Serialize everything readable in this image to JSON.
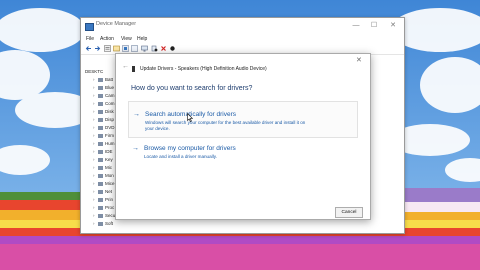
{
  "window": {
    "title": "Device Manager",
    "controls": {
      "minimize": "—",
      "maximize": "☐",
      "close": "✕"
    },
    "menu": [
      "File",
      "Action",
      "View",
      "Help"
    ],
    "tree": {
      "root": "DESKTC",
      "items": [
        "Batt",
        "Blue",
        "Cam",
        "Com",
        "Disk",
        "Disp",
        "DVD",
        "Firm",
        "Hum",
        "IDE",
        "Key",
        "Mic",
        "Mon",
        "Mice",
        "Net",
        "Prin",
        "Proc",
        "Secu",
        "Soft"
      ]
    }
  },
  "dialog": {
    "title": "Update Drivers - Speakers (High Definition Audio Device)",
    "question": "How do you want to search for drivers?",
    "option1": {
      "title": "Search automatically for drivers",
      "desc_line1": "Windows will search your computer for the best available driver and install it on",
      "desc_line2": "your device."
    },
    "option2": {
      "title": "Browse my computer for drivers",
      "desc": "Locate and install a driver manually."
    },
    "cancel_label": "Cancel",
    "back_glyph": "←",
    "close_glyph": "✕",
    "arrow_glyph": "→"
  },
  "colors": {
    "link": "#1a5aa6",
    "heading": "#1e3d6e"
  },
  "icons": [
    "device-manager-icon",
    "back-icon",
    "forward-icon",
    "properties-icon",
    "scan-icon",
    "update-driver-icon",
    "disable-icon",
    "uninstall-icon",
    "speaker-icon",
    "cursor-icon"
  ]
}
